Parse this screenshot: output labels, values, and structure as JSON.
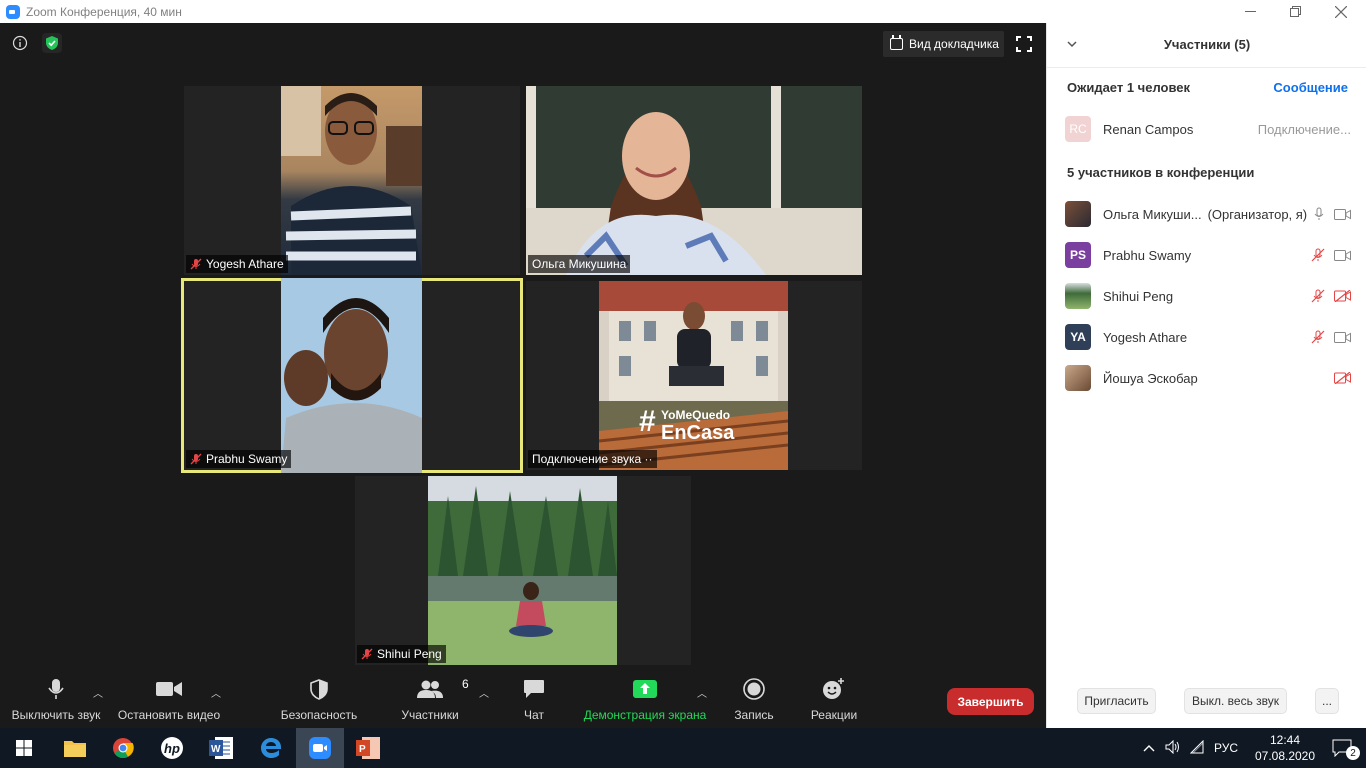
{
  "window": {
    "title": "Zoom Конференция, 40 мин"
  },
  "top": {
    "speaker_view_label": "Вид докладчика"
  },
  "tiles": [
    {
      "name": "Yogesh Athare",
      "muted": true
    },
    {
      "name": "Ольга Микушина",
      "muted": false
    },
    {
      "name": "Prabhu Swamy",
      "muted": true,
      "active": true
    },
    {
      "name": "Подключение звука ··",
      "muted": false
    },
    {
      "name": "Shihui Peng",
      "muted": true
    }
  ],
  "toolbar": {
    "mute_label": "Выключить звук",
    "video_label": "Остановить видео",
    "security_label": "Безопасность",
    "participants_label": "Участники",
    "participants_count": "6",
    "chat_label": "Чат",
    "share_label": "Демонстрация экрана",
    "record_label": "Запись",
    "reactions_label": "Реакции",
    "end_label": "Завершить",
    "share_color": "#23d959"
  },
  "panel": {
    "title": "Участники (5)",
    "waiting_label": "Ожидает 1 человек",
    "message_link": "Сообщение",
    "waiting_person": {
      "initials": "RC",
      "name": "Renan Campos",
      "status": "Подключение..."
    },
    "section_label": "5 участников в конференции",
    "participants": [
      {
        "name": "Ольга Микуши...",
        "role": "(Организатор, я)",
        "avatar": "photo",
        "mic": "on",
        "video": "on"
      },
      {
        "name": "Prabhu Swamy",
        "initials": "PS",
        "avatar_color": "#7b3fa0",
        "mic": "off",
        "video": "on"
      },
      {
        "name": "Shihui Peng",
        "avatar": "photo",
        "mic": "off",
        "video": "off"
      },
      {
        "name": "Yogesh Athare",
        "initials": "YA",
        "avatar_color": "#2f3f57",
        "mic": "off",
        "video": "on"
      },
      {
        "name": "Йошуа Эскобар",
        "avatar": "photo",
        "mic": "none",
        "video": "off"
      }
    ],
    "invite_label": "Пригласить",
    "mute_all_label": "Выкл. весь звук",
    "more_label": "..."
  },
  "taskbar": {
    "lang": "РУС",
    "time": "12:44",
    "date": "07.08.2020",
    "notifications": "2"
  }
}
